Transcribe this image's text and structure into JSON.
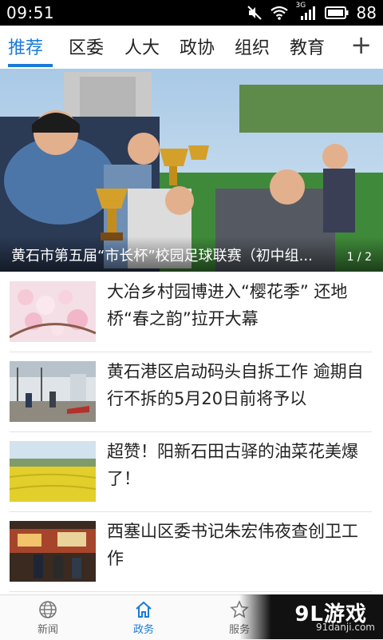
{
  "status_bar": {
    "time": "09:51",
    "network": "3G",
    "battery": "88"
  },
  "tabs": [
    {
      "label": "推荐",
      "active": true
    },
    {
      "label": "区委"
    },
    {
      "label": "人大"
    },
    {
      "label": "政协"
    },
    {
      "label": "组织"
    },
    {
      "label": "教育"
    }
  ],
  "tabs_add": "+",
  "hero": {
    "caption": "黄石市第五届“市长杯”校园足球联赛（初中组...",
    "page": "1 / 2"
  },
  "news": [
    {
      "title": "大冶乡村园博进入“樱花季” 还地桥“春之韵”拉开大幕"
    },
    {
      "title": "黄石港区启动码头自拆工作 逾期自行不拆的5月20日前将予以"
    },
    {
      "title": "超赞！阳新石田古驿的油菜花美爆了！"
    },
    {
      "title": "西塞山区委书记朱宏伟夜查创卫工作"
    }
  ],
  "bottom_nav": [
    {
      "label": "新闻",
      "icon": "globe-icon"
    },
    {
      "label": "政务",
      "icon": "home-icon",
      "active": true
    },
    {
      "label": "服务",
      "icon": "star-icon"
    }
  ],
  "watermark": {
    "logo": "9L游戏",
    "url": "91danji.com"
  },
  "colors": {
    "accent": "#1a7ad8"
  }
}
